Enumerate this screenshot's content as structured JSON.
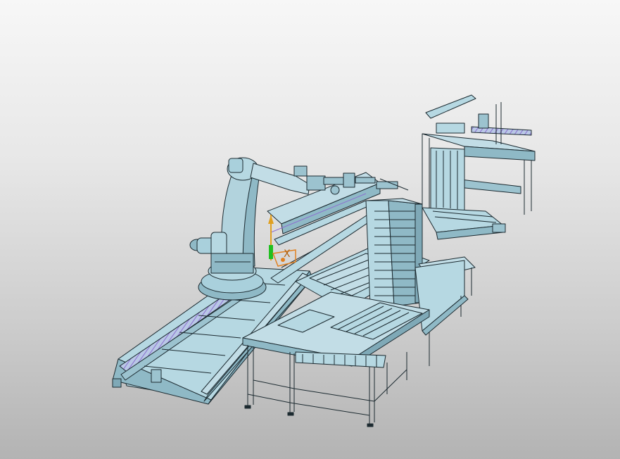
{
  "viewport": {
    "background_top": "#f7f7f7",
    "background_bottom": "#b3b3b3"
  },
  "model": {
    "fill": "#a9d0dc",
    "fill_dark": "#7fa9b7",
    "edge": "#1c2a30",
    "rail_accent": "#c0b8e8"
  },
  "triad": {
    "x_label": "X",
    "z_color": "#e0a020",
    "y_color": "#20c020",
    "x_color": "#e08020"
  }
}
